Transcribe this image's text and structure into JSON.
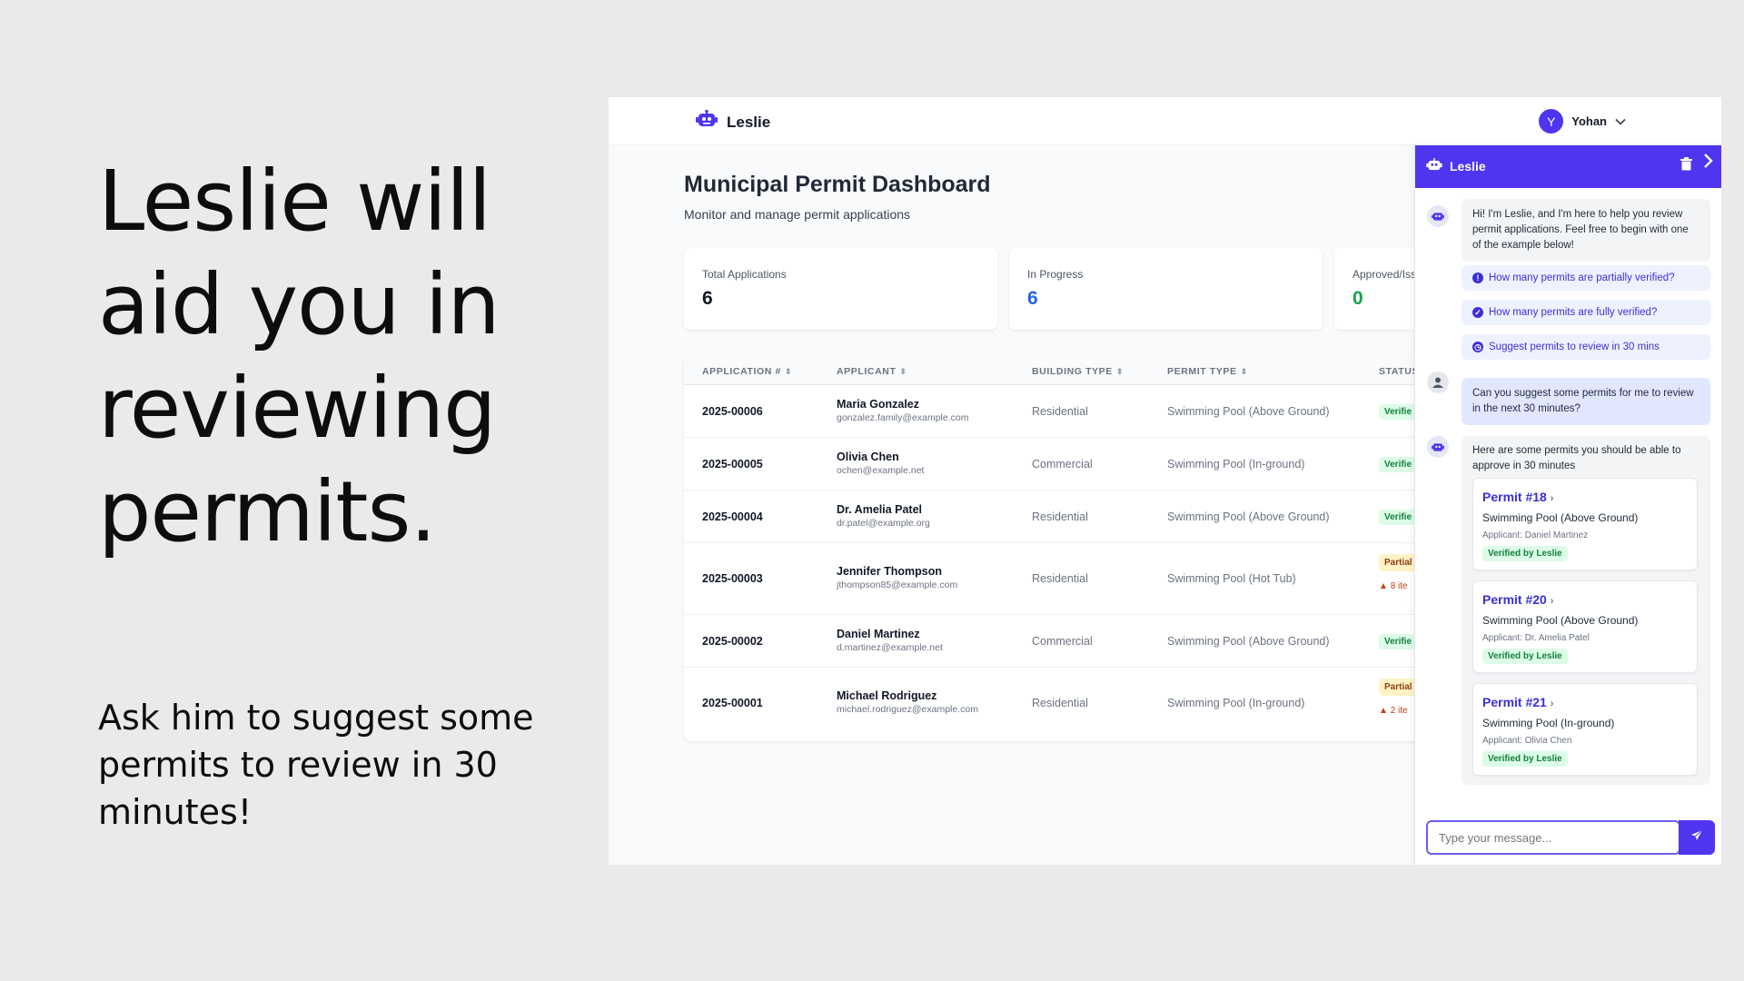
{
  "promo": {
    "headline": "Leslie will aid you in reviewing permits.",
    "subline": "Ask him to suggest some permits to review in 30 minutes!"
  },
  "colors": {
    "brand": "#4f35f0",
    "verified": "#15803d",
    "partial": "#92400e",
    "in_progress": "#2563eb",
    "approved": "#16a34a"
  },
  "header": {
    "app_name": "Leslie",
    "user_initial": "Y",
    "user_name": "Yohan"
  },
  "dashboard": {
    "title": "Municipal Permit Dashboard",
    "subtitle": "Monitor and manage permit applications",
    "stats": [
      {
        "label": "Total Applications",
        "value": "6"
      },
      {
        "label": "In Progress",
        "value": "6"
      },
      {
        "label": "Approved/Iss",
        "value": "0"
      }
    ]
  },
  "table": {
    "headers": [
      "APPLICATION #",
      "APPLICANT",
      "BUILDING TYPE",
      "PERMIT TYPE",
      "STATUS"
    ],
    "rows": [
      {
        "id": "2025-00006",
        "name": "Maria Gonzalez",
        "email": "gonzalez.family@example.com",
        "building": "Residential",
        "permit": "Swimming Pool (Above Ground)",
        "status": "Verifie"
      },
      {
        "id": "2025-00005",
        "name": "Olivia Chen",
        "email": "ochen@example.net",
        "building": "Commercial",
        "permit": "Swimming Pool (In-ground)",
        "status": "Verifie"
      },
      {
        "id": "2025-00004",
        "name": "Dr. Amelia Patel",
        "email": "dr.patel@example.org",
        "building": "Residential",
        "permit": "Swimming Pool (Above Ground)",
        "status": "Verifie"
      },
      {
        "id": "2025-00003",
        "name": "Jennifer Thompson",
        "email": "jthompson85@example.com",
        "building": "Residential",
        "permit": "Swimming Pool (Hot Tub)",
        "status": "Partial",
        "note": "8 ite"
      },
      {
        "id": "2025-00002",
        "name": "Daniel Martinez",
        "email": "d.martinez@example.net",
        "building": "Commercial",
        "permit": "Swimming Pool (Above Ground)",
        "status": "Verifie"
      },
      {
        "id": "2025-00001",
        "name": "Michael Rodriguez",
        "email": "michael.rodriguez@example.com",
        "building": "Residential",
        "permit": "Swimming Pool (In-ground)",
        "status": "Partial",
        "note": "2 ite"
      }
    ]
  },
  "chat": {
    "title": "Leslie",
    "greeting": "Hi! I'm Leslie, and I'm here to help you review permit applications. Feel free to begin with one of the example below!",
    "suggestions": [
      {
        "label": "How many permits are partially verified?",
        "icon": "info-icon"
      },
      {
        "label": "How many permits are fully verified?",
        "icon": "check-icon"
      },
      {
        "label": "Suggest permits to review in 30 mins",
        "icon": "clock-icon"
      }
    ],
    "user_message": "Can you suggest some permits for me to review in the next 30 minutes?",
    "reply": "Here are some permits you should be able to approve in 30 minutes",
    "cards": [
      {
        "title": "Permit #18",
        "type": "Swimming Pool (Above Ground)",
        "applicant": "Applicant: Daniel Martinez",
        "badge": "Verified by Leslie"
      },
      {
        "title": "Permit #20",
        "type": "Swimming Pool (Above Ground)",
        "applicant": "Applicant: Dr. Amelia Patel",
        "badge": "Verified by Leslie"
      },
      {
        "title": "Permit #21",
        "type": "Swimming Pool (In-ground)",
        "applicant": "Applicant: Olivia Chen",
        "badge": "Verified by Leslie"
      }
    ],
    "input_placeholder": "Type your message..."
  }
}
